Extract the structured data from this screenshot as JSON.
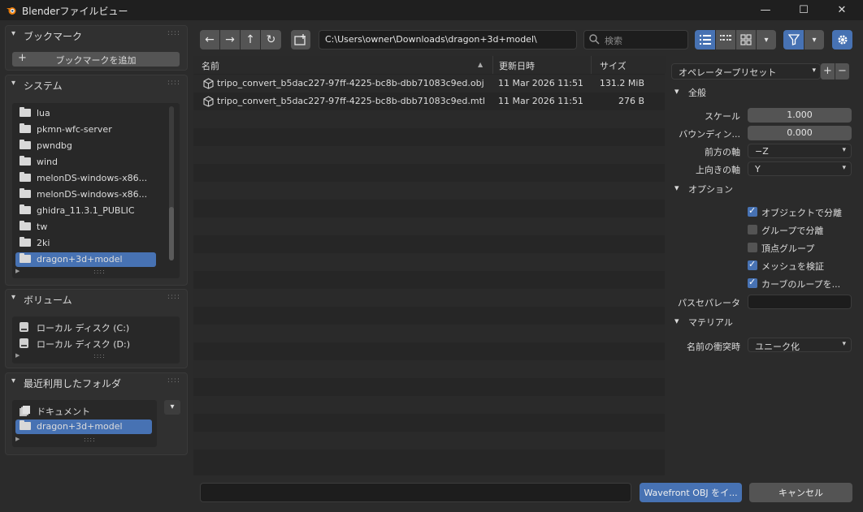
{
  "window": {
    "title": "Blenderファイルビュー",
    "minimize_glyph": "—",
    "maximize_glyph": "☐",
    "close_glyph": "✕"
  },
  "sidebar": {
    "bookmarks": {
      "title": "ブックマーク",
      "add_label": "ブックマークを追加",
      "add_glyph": "+"
    },
    "system": {
      "title": "システム",
      "items": [
        {
          "label": "lua"
        },
        {
          "label": "pkmn-wfc-server"
        },
        {
          "label": "pwndbg"
        },
        {
          "label": "wind"
        },
        {
          "label": "melonDS-windows-x86..."
        },
        {
          "label": "melonDS-windows-x86..."
        },
        {
          "label": "ghidra_11.3.1_PUBLIC"
        },
        {
          "label": "tw"
        },
        {
          "label": "2ki"
        },
        {
          "label": "dragon+3d+model",
          "selected": true
        }
      ]
    },
    "volumes": {
      "title": "ボリューム",
      "items": [
        {
          "label": "ローカル ディスク (C:)"
        },
        {
          "label": "ローカル ディスク (D:)"
        }
      ]
    },
    "recent": {
      "title": "最近利用したフォルダ",
      "items": [
        {
          "label": "ドキュメント"
        },
        {
          "label": "dragon+3d+model",
          "selected": true
        }
      ]
    }
  },
  "toolbar": {
    "back_glyph": "←",
    "forward_glyph": "→",
    "parent_glyph": "↑",
    "refresh_glyph": "↻",
    "path": "C:\\Users\\owner\\Downloads\\dragon+3d+model\\",
    "search_placeholder": "検索"
  },
  "filelist": {
    "columns": {
      "name": "名前",
      "sort_glyph": "▲",
      "date": "更新日時",
      "size": "サイズ"
    },
    "rows": [
      {
        "name": "tripo_convert_b5dac227-97ff-4225-bc8b-dbb71083c9ed.obj",
        "date": "11 Mar 2026 11:51",
        "size": "131.2 MiB"
      },
      {
        "name": "tripo_convert_b5dac227-97ff-4225-bc8b-dbb71083c9ed.mtl",
        "date": "11 Mar 2026 11:51",
        "size": "276 B"
      }
    ]
  },
  "operator": {
    "preset_label": "オペレータープリセット",
    "plus_glyph": "+",
    "minus_glyph": "−",
    "general": {
      "title": "全般",
      "scale_label": "スケール",
      "scale_value": "1.000",
      "bounds_label": "バウンディン...",
      "bounds_value": "0.000",
      "forward_label": "前方の軸",
      "forward_value": "−Z",
      "up_label": "上向きの軸",
      "up_value": "Y"
    },
    "options": {
      "title": "オプション",
      "checks": [
        {
          "label": "オブジェクトで分離",
          "checked": true
        },
        {
          "label": "グループで分離",
          "checked": false
        },
        {
          "label": "頂点グループ",
          "checked": false
        },
        {
          "label": "メッシュを検証",
          "checked": true
        },
        {
          "label": "カーブのループを...",
          "checked": true
        }
      ],
      "path_sep_label": "パスセパレータ",
      "path_sep_value": ""
    },
    "materials": {
      "title": "マテリアル",
      "clash_label": "名前の衝突時",
      "clash_value": "ユニーク化"
    }
  },
  "bottom": {
    "filename_value": "",
    "confirm_label": "Wavefront OBJ をイ...",
    "cancel_label": "キャンセル"
  },
  "colors": {
    "accent": "#4772b3",
    "bg": "#2b2b2b",
    "button": "#545454"
  }
}
